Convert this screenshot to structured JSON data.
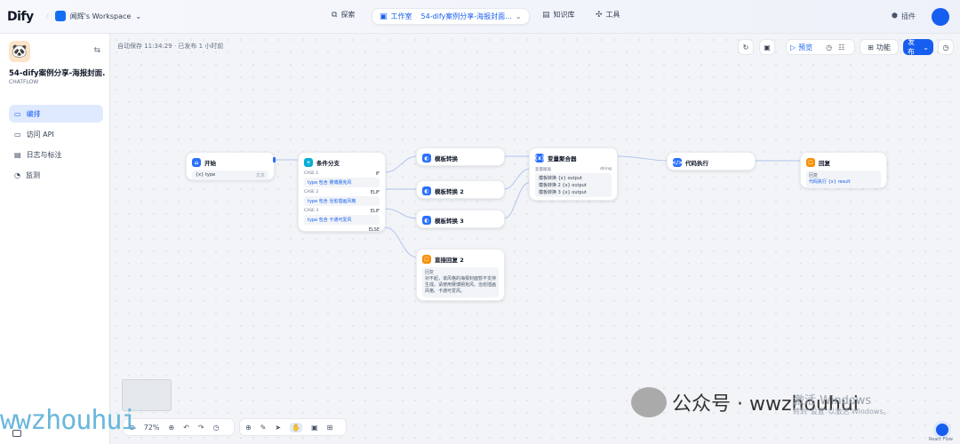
{
  "topbar": {
    "logo": "Dify",
    "workspace": "闻辉's Workspace",
    "nav": [
      {
        "label": "探索"
      },
      {
        "label": "工作室",
        "sub": "54-dify案例分享-海报封面..."
      },
      {
        "label": "知识库"
      },
      {
        "label": "工具"
      }
    ],
    "plugin": "插件"
  },
  "sidebar": {
    "app_name": "54-dify案例分享-海报封面...",
    "app_type": "CHATFLOW",
    "menu": [
      {
        "label": "编排"
      },
      {
        "label": "访问 API"
      },
      {
        "label": "日志与标注"
      },
      {
        "label": "监测"
      }
    ]
  },
  "canvas": {
    "autosave": "自动保存 11:34:29 · 已发布 1 小时前",
    "toolbar": {
      "preview": "预览",
      "features": "功能",
      "publish": "发布"
    },
    "zoom": "72%"
  },
  "nodes": {
    "start": {
      "title": "开始",
      "var": "type",
      "var_type": "文本"
    },
    "cond": {
      "title": "条件分支",
      "cases": [
        {
          "label": "CASE 1",
          "branch": "IF",
          "cond": "type 包含 赛博朋克风"
        },
        {
          "label": "CASE 2",
          "branch": "ELIF",
          "cond": "type 包含 治愈插画风格"
        },
        {
          "label": "CASE 3",
          "branch": "ELIF",
          "cond": "type 包含 卡通可爱风"
        }
      ],
      "else": "ELSE"
    },
    "tpl1": {
      "title": "模板转换"
    },
    "tpl2": {
      "title": "模板转换 2"
    },
    "tpl3": {
      "title": "模板转换 3"
    },
    "reply2": {
      "title": "直接回复 2",
      "label": "回复",
      "text": "对不起，该风格的海报封面暂不支持生成。请使用赛博朋克风、治愈插画风格、卡通可爱风。"
    },
    "agg": {
      "title": "变量聚合器",
      "group": "变量赋值",
      "type": "string",
      "items": [
        "模板转换 {x} output",
        "模板转换 2 {x} output",
        "模板转换 3 {x} output"
      ]
    },
    "code": {
      "title": "代码执行"
    },
    "reply": {
      "title": "回复",
      "label": "回复",
      "value": "代码执行 {x} result"
    }
  },
  "watermark": {
    "left": "wwzhouhui",
    "right": "公众号 · wwzhouhui",
    "activate1": "激活 Windows",
    "activate2": "转到\"设置\"以激活 Windows。",
    "reactflow": "React Flow"
  }
}
